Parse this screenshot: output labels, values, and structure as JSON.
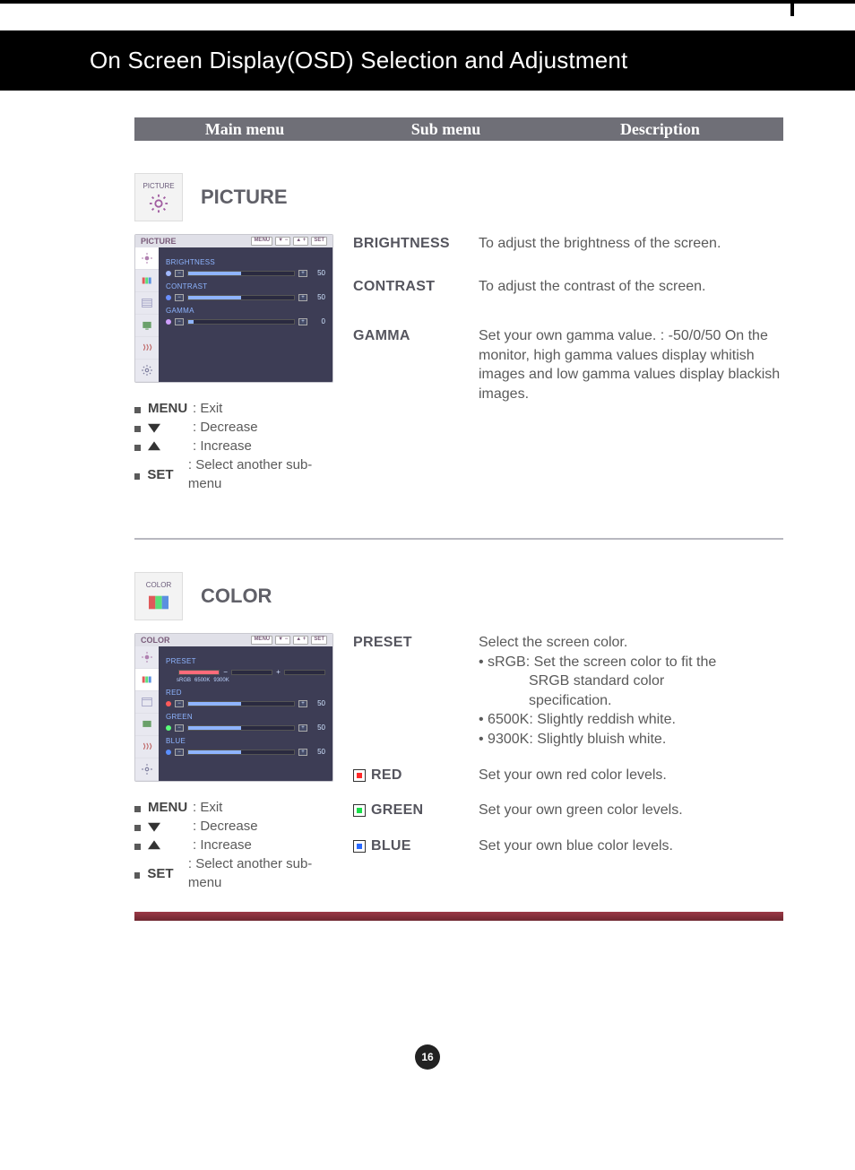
{
  "page_title": "On Screen Display(OSD) Selection and Adjustment",
  "tabs": {
    "main": "Main menu",
    "sub": "Sub menu",
    "desc": "Description"
  },
  "sections": {
    "picture": {
      "chip_label": "PICTURE",
      "title": "PICTURE",
      "osd": {
        "header": "PICTURE",
        "btn_menu": "MENU",
        "btn_set": "SET",
        "rows": {
          "brightness": {
            "label": "BRIGHTNESS",
            "value": "50"
          },
          "contrast": {
            "label": "CONTRAST",
            "value": "50"
          },
          "gamma": {
            "label": "GAMMA",
            "value": "0"
          }
        }
      },
      "entries": {
        "brightness": {
          "label": "BRIGHTNESS",
          "desc": "To adjust the brightness of the screen."
        },
        "contrast": {
          "label": "CONTRAST",
          "desc": "To adjust the contrast of the screen."
        },
        "gamma": {
          "label": "GAMMA",
          "desc": "Set your own gamma value. : -50/0/50 On the monitor, high gamma values display whitish images and low gamma values display blackish images."
        }
      }
    },
    "color": {
      "chip_label": "COLOR",
      "title": "COLOR",
      "osd": {
        "header": "COLOR",
        "btn_menu": "MENU",
        "btn_set": "SET",
        "rows": {
          "preset": {
            "label": "PRESET",
            "ticks": [
              "sRGB",
              "6500K",
              "9300K"
            ]
          },
          "red": {
            "label": "RED",
            "value": "50"
          },
          "green": {
            "label": "GREEN",
            "value": "50"
          },
          "blue": {
            "label": "BLUE",
            "value": "50"
          }
        }
      },
      "entries": {
        "preset": {
          "label": "PRESET",
          "desc_intro": "Select the screen color.",
          "b1_head": "• sRGB: ",
          "b1_rest": "Set the screen color to fit the",
          "b1_l2": "SRGB standard color",
          "b1_l3": "specification.",
          "b2": "• 6500K: Slightly reddish white.",
          "b3": "• 9300K: Slightly bluish white."
        },
        "red": {
          "label": "RED",
          "desc": "Set your own red color levels."
        },
        "green": {
          "label": "GREEN",
          "desc": "Set your own green color levels."
        },
        "blue": {
          "label": "BLUE",
          "desc": "Set your own blue color levels."
        }
      }
    }
  },
  "legend": {
    "menu_key": "MENU",
    "menu_txt": ": Exit",
    "down_txt": ": Decrease",
    "up_txt": ": Increase",
    "set_key": "SET",
    "set_txt": ": Select another sub-menu"
  },
  "page_number": "16"
}
